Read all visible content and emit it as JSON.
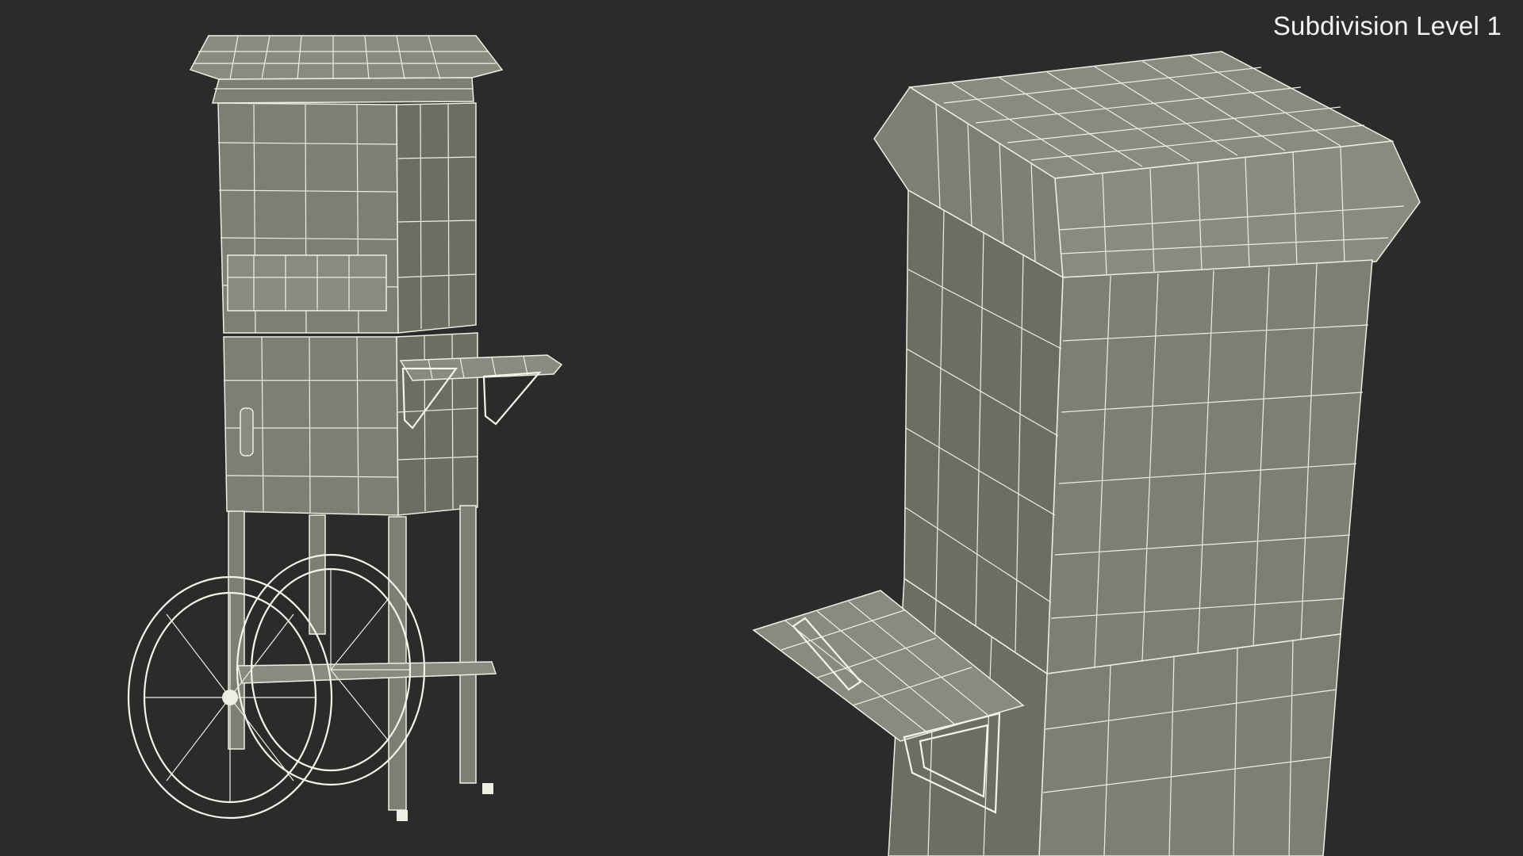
{
  "render": {
    "label": "Subdivision Level 1",
    "background_color": "#2b2b2b",
    "wire_color": "#eeeee2",
    "surface_color": "#7e7e74"
  },
  "views": [
    {
      "name": "full-cart-view"
    },
    {
      "name": "closeup-view"
    }
  ]
}
